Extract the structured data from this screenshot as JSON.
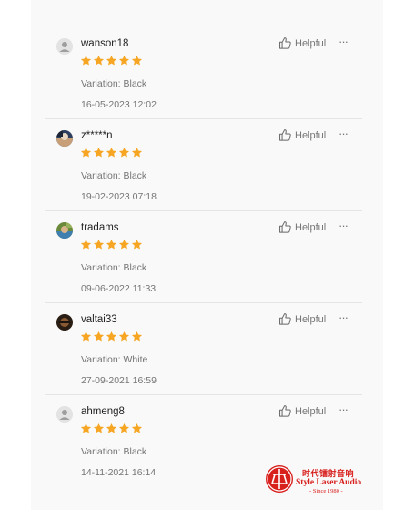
{
  "reviews": [
    {
      "username": "wanson18",
      "rating": 5,
      "variation": "Variation: Black",
      "timestamp": "16-05-2023 12:02",
      "helpful_label": "Helpful",
      "more_label": "···",
      "avatar": "default-user-icon"
    },
    {
      "username": "z*****n",
      "rating": 5,
      "variation": "Variation: Black",
      "timestamp": "19-02-2023 07:18",
      "helpful_label": "Helpful",
      "more_label": "···",
      "avatar": "photo-avatar"
    },
    {
      "username": "tradams",
      "rating": 5,
      "variation": "Variation: Black",
      "timestamp": "09-06-2022 11:33",
      "helpful_label": "Helpful",
      "more_label": "···",
      "avatar": "photo-avatar"
    },
    {
      "username": "valtai33",
      "rating": 5,
      "variation": "Variation: White",
      "timestamp": "27-09-2021 16:59",
      "helpful_label": "Helpful",
      "more_label": "···",
      "avatar": "photo-avatar"
    },
    {
      "username": "ahmeng8",
      "rating": 5,
      "variation": "Variation: Black",
      "timestamp": "14-11-2021 16:14",
      "helpful_label": "Helpful",
      "more_label": "···",
      "avatar": "default-user-icon"
    }
  ],
  "watermark": {
    "chinese": "时代镭射音响",
    "english": "Style Laser Audio",
    "since": "- Since 1980 -"
  },
  "colors": {
    "star": "#f6a623",
    "text_muted": "#757575",
    "watermark_red": "#d8201d"
  }
}
